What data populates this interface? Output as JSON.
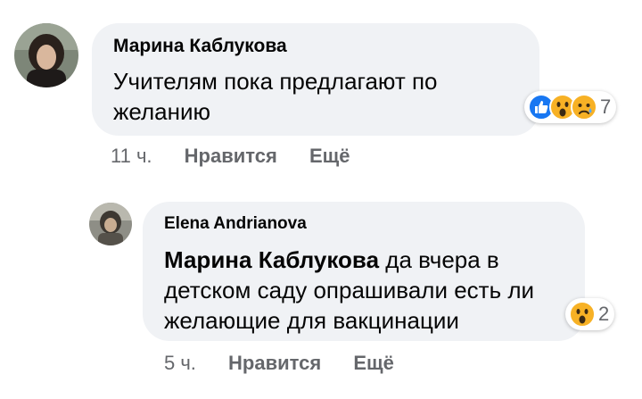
{
  "comments": [
    {
      "author": "Марина Каблукова",
      "text": "Учителям пока предлагают по желанию",
      "reactions": {
        "icons": [
          "like-icon",
          "wow-icon",
          "sad-icon"
        ],
        "count": "7"
      },
      "time": "11 ч.",
      "like_label": "Нравится",
      "more_label": "Ещё"
    },
    {
      "author": "Elena Andrianova",
      "mention": "Марина Каблукова",
      "text": " да вчера в детском саду опрашивали есть ли желающие для вакцинации",
      "reactions": {
        "icons": [
          "wow-icon"
        ],
        "count": "2"
      },
      "time": "5 ч.",
      "like_label": "Нравится",
      "more_label": "Ещё"
    }
  ],
  "colors": {
    "bubble": "#f0f2f5",
    "meta": "#65676b",
    "like": "#1877f2",
    "emoji": "#f7b125"
  }
}
